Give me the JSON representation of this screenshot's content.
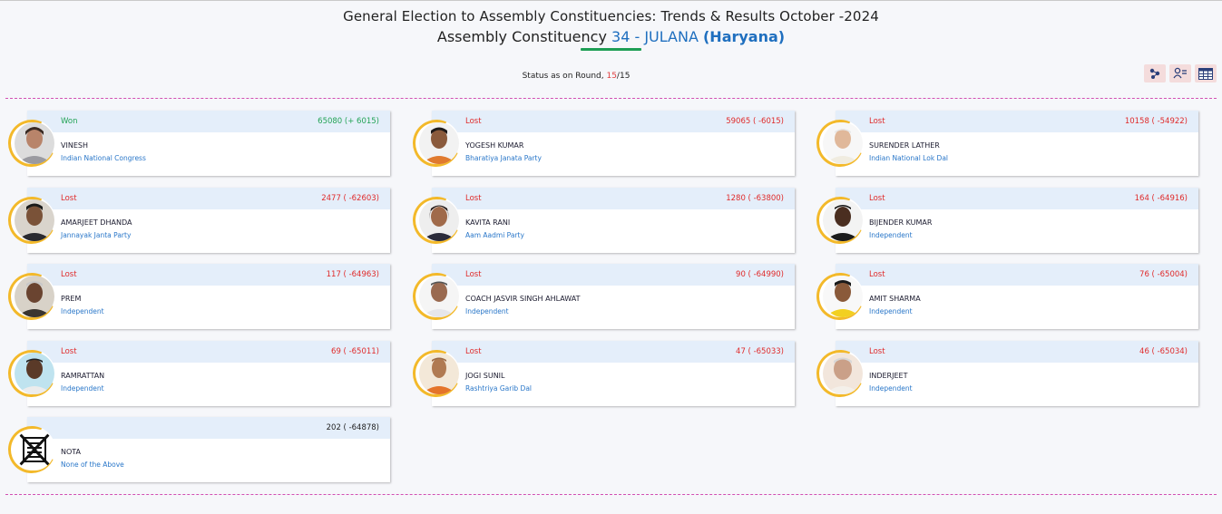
{
  "header": {
    "title_line1": "General Election to Assembly Constituencies: Trends & Results October -2024",
    "title_prefix": "Assembly Constituency",
    "ac_number": "34 - JULANA",
    "state": "(Haryana)"
  },
  "status": {
    "label": "Status as on Round,",
    "current_round": "15",
    "separator": "/",
    "total_rounds": "15"
  },
  "toolbar": {
    "icons": [
      "network-icon",
      "user-list-icon",
      "table-icon"
    ]
  },
  "candidates": [
    {
      "status": "Won",
      "votes": "65080 (+ 6015)",
      "name": "VINESH",
      "party": "Indian National Congress"
    },
    {
      "status": "Lost",
      "votes": "59065 ( -6015)",
      "name": "YOGESH KUMAR",
      "party": "Bharatiya Janata Party"
    },
    {
      "status": "Lost",
      "votes": "10158 ( -54922)",
      "name": "SURENDER LATHER",
      "party": "Indian National Lok Dal"
    },
    {
      "status": "Lost",
      "votes": "2477 ( -62603)",
      "name": "AMARJEET DHANDA",
      "party": "Jannayak Janta Party"
    },
    {
      "status": "Lost",
      "votes": "1280 ( -63800)",
      "name": "KAVITA RANI",
      "party": "Aam Aadmi Party"
    },
    {
      "status": "Lost",
      "votes": "164 ( -64916)",
      "name": "BIJENDER KUMAR",
      "party": "Independent"
    },
    {
      "status": "Lost",
      "votes": "117 ( -64963)",
      "name": "PREM",
      "party": "Independent"
    },
    {
      "status": "Lost",
      "votes": "90 ( -64990)",
      "name": "COACH JASVIR SINGH AHLAWAT",
      "party": "Independent"
    },
    {
      "status": "Lost",
      "votes": "76 ( -65004)",
      "name": "AMIT SHARMA",
      "party": "Independent"
    },
    {
      "status": "Lost",
      "votes": "69 ( -65011)",
      "name": "RAMRATTAN",
      "party": "Independent"
    },
    {
      "status": "Lost",
      "votes": "47 ( -65033)",
      "name": "JOGI SUNIL",
      "party": "Rashtriya Garib Dal"
    },
    {
      "status": "Lost",
      "votes": "46 ( -65034)",
      "name": "INDERJEET",
      "party": "Independent"
    },
    {
      "status": "",
      "votes": "202 ( -64878)",
      "name": "NOTA",
      "party": "None of the Above"
    }
  ],
  "colors": {
    "won": "#23a356",
    "lost": "#e02a2a",
    "party": "#2a77c9",
    "band": "#e4eefa",
    "ring": "#f3b92a",
    "divider": "#d24fb3"
  }
}
